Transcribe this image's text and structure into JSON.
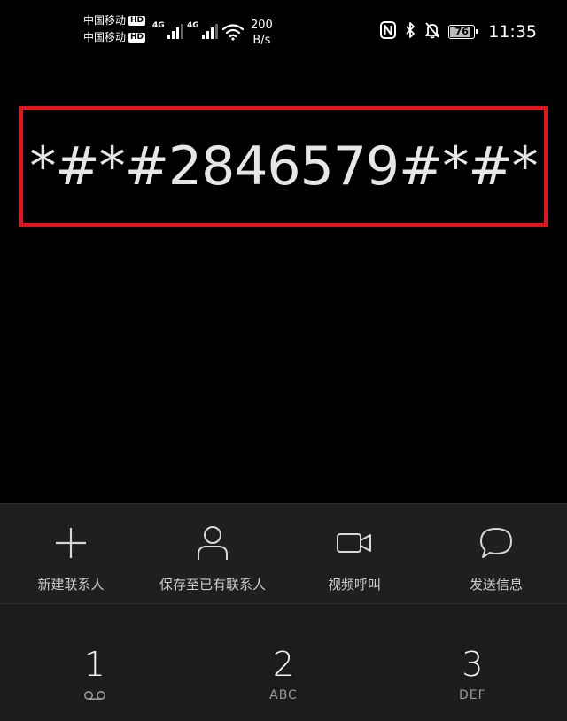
{
  "status_bar": {
    "carriers": [
      {
        "name": "中国移动",
        "badge": "HD"
      },
      {
        "name": "中国移动",
        "badge": "HD"
      }
    ],
    "signals": [
      {
        "network": "4G",
        "level": 3
      },
      {
        "network": "4G",
        "level": 3
      }
    ],
    "net_speed_value": "200",
    "net_speed_unit": "B/s",
    "icons": [
      "nfc-icon",
      "bluetooth-icon",
      "bell-off-icon"
    ],
    "battery_level": "76",
    "time": "11:35"
  },
  "dialer": {
    "number": "*#*#2846579#*#*",
    "highlight_color": "#e1161a"
  },
  "actions": [
    {
      "label": "新建联系人",
      "icon": "plus-icon"
    },
    {
      "label": "保存至已有联系人",
      "icon": "person-icon"
    },
    {
      "label": "视频呼叫",
      "icon": "video-camera-icon"
    },
    {
      "label": "发送信息",
      "icon": "message-bubble-icon"
    }
  ],
  "keypad": [
    {
      "digit": "1",
      "letters": "",
      "sub_icon": "voicemail-icon"
    },
    {
      "digit": "2",
      "letters": "ABC"
    },
    {
      "digit": "3",
      "letters": "DEF"
    }
  ]
}
